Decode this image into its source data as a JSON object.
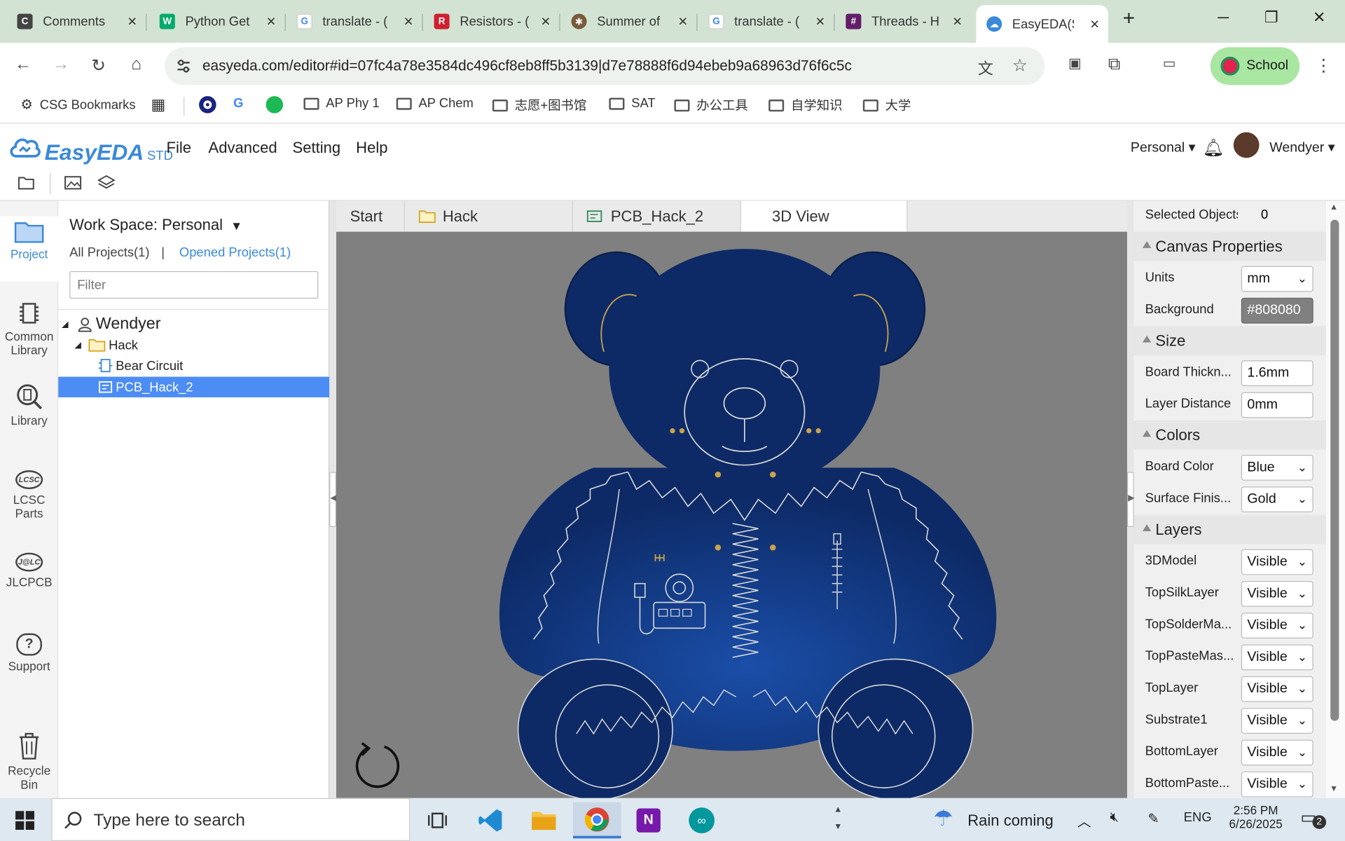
{
  "browser": {
    "tabs": [
      {
        "label": "Comments",
        "icon": "docs-icon",
        "color": "#444"
      },
      {
        "label": "Python Get",
        "icon": "w3schools-icon",
        "color": "#04aa6d"
      },
      {
        "label": "translate - (",
        "icon": "google-icon",
        "color": "#4285f4"
      },
      {
        "label": "Resistors - (",
        "icon": "resistor-icon",
        "color": "#d0202f"
      },
      {
        "label": "Summer of",
        "icon": "compass-icon",
        "color": "#7a5a3a"
      },
      {
        "label": "translate - (",
        "icon": "google-icon",
        "color": "#4285f4"
      },
      {
        "label": "Threads - H",
        "icon": "slack-icon",
        "color": "#611f69"
      },
      {
        "label": "EasyEDA(St",
        "icon": "easyeda-icon",
        "color": "#3b8ad8"
      }
    ],
    "new_tab": "+",
    "url": "easyeda.com/editor#id=07fc4a78e3584dc496cf8eb8ff5b3139|d7e78888f6d94ebeb9a68963d76f6c5c",
    "profile": "School",
    "bookmarks": [
      {
        "label": "CSG Bookmarks",
        "type": "gear-folder"
      },
      {
        "label": "",
        "type": "apps"
      },
      {
        "label": "",
        "type": "o-icon"
      },
      {
        "label": "",
        "type": "google"
      },
      {
        "label": "",
        "type": "spotify"
      },
      {
        "label": "AP Phy 1",
        "type": "folder"
      },
      {
        "label": "AP Chem",
        "type": "folder"
      },
      {
        "label": "志愿+图书馆",
        "type": "folder"
      },
      {
        "label": "SAT",
        "type": "folder"
      },
      {
        "label": "办公工具",
        "type": "folder"
      },
      {
        "label": "自学知识",
        "type": "folder"
      },
      {
        "label": "大学",
        "type": "folder"
      }
    ]
  },
  "app": {
    "logo_name": "EasyEDA",
    "logo_std": "STD",
    "menus": [
      "File",
      "Advanced",
      "Setting",
      "Help"
    ],
    "workspace_menu": "Personal",
    "user": "Wendyer"
  },
  "leftnav": {
    "items": [
      "Project",
      "Common Library",
      "Library",
      "LCSC Parts",
      "JLCPCB",
      "Support",
      "Recycle Bin"
    ]
  },
  "project_panel": {
    "workspace": "Work Space: Personal",
    "all_projects": "All Projects(1)",
    "separator": "|",
    "opened_projects": "Opened Projects(1)",
    "filter_placeholder": "Filter",
    "tree": {
      "owner": "Wendyer",
      "project": "Hack",
      "items": [
        "Bear Circuit",
        "PCB_Hack_2"
      ]
    }
  },
  "doc_tabs": [
    "Start",
    "Hack",
    "PCB_Hack_2",
    "3D View"
  ],
  "right_panel": {
    "selected_label": "Selected Objects",
    "selected_count": "0",
    "sections": {
      "canvas": "Canvas Properties",
      "size": "Size",
      "colors": "Colors",
      "layers": "Layers"
    },
    "units_label": "Units",
    "units_value": "mm",
    "background_label": "Background",
    "background_value": "#808080",
    "thickness_label": "Board Thickn...",
    "thickness_value": "1.6mm",
    "layer_distance_label": "Layer Distance",
    "layer_distance_value": "0mm",
    "board_color_label": "Board Color",
    "board_color_value": "Blue",
    "surface_label": "Surface Finis...",
    "surface_value": "Gold",
    "layers": [
      {
        "name": "3DModel",
        "value": "Visible"
      },
      {
        "name": "TopSilkLayer",
        "value": "Visible"
      },
      {
        "name": "TopSolderMa...",
        "value": "Visible"
      },
      {
        "name": "TopPasteMas...",
        "value": "Visible"
      },
      {
        "name": "TopLayer",
        "value": "Visible"
      },
      {
        "name": "Substrate1",
        "value": "Visible"
      },
      {
        "name": "BottomLayer",
        "value": "Visible"
      },
      {
        "name": "BottomPaste...",
        "value": "Visible"
      }
    ]
  },
  "taskbar": {
    "search_placeholder": "Type here to search",
    "weather": "Rain coming",
    "lang": "ENG",
    "time": "2:56 PM",
    "date": "6/26/2025",
    "notifications": "2"
  },
  "colors": {
    "board": "#0d2a66",
    "canvas_bg": "#808080",
    "accent": "#3b8ad8",
    "selection": "#4c8df5"
  }
}
